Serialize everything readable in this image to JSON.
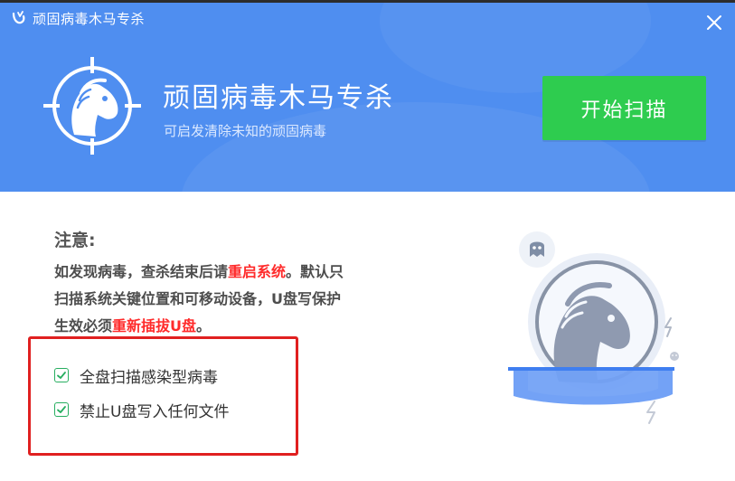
{
  "window": {
    "title": "顽固病毒木马专杀",
    "close_symbol": "✕"
  },
  "header": {
    "title": "顽固病毒木马专杀",
    "subtitle": "可启发清除未知的顽固病毒",
    "scan_button": "开始扫描"
  },
  "notice": {
    "title": "注意:",
    "line1_a": "如发现病毒，查杀结束后请",
    "line1_highlight": "重启系统",
    "line1_b": "。默认只",
    "line2": "扫描系统关键位置和可移动设备，U盘写保护",
    "line3_a": "生效必须",
    "line3_highlight": "重新插拔U盘",
    "line3_b": "。"
  },
  "options": [
    {
      "label": "全盘扫描感染型病毒",
      "checked": true
    },
    {
      "label": "禁止U盘写入任何文件",
      "checked": true
    }
  ],
  "colors": {
    "header_blue": "#4f8ef0",
    "button_green": "#2ecc4f",
    "highlight_red": "#ff2b2b",
    "checkbox_green": "#27ae60",
    "annotation_red": "#e02020"
  },
  "icons": {
    "titlebar": "antivirus-logo-icon",
    "logo": "horse-crosshair-icon",
    "close": "close-icon",
    "checkbox": "checkmark-icon",
    "illustration": "horse-shield-icon"
  }
}
